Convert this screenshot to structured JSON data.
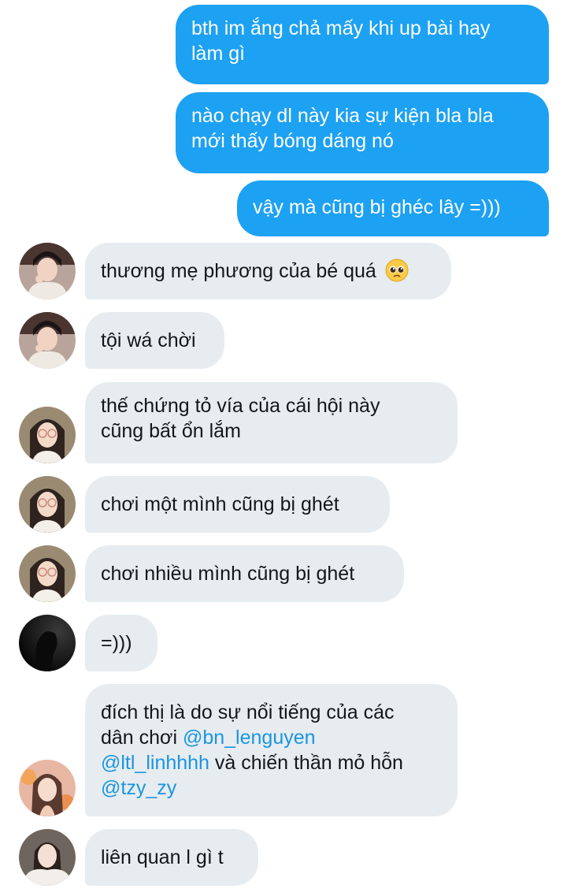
{
  "messages": {
    "sent": [
      {
        "lines": [
          "bth im ắng chả mấy khi up bài hay",
          "làm gì"
        ]
      },
      {
        "lines": [
          "nào chạy dl này kia sự kiện bla bla",
          "mới thấy bóng dáng nó"
        ]
      },
      {
        "lines": [
          "vậy mà cũng bị ghéc lây =)))"
        ]
      }
    ],
    "received": [
      {
        "text": "thương mẹ phương của bé quá",
        "emoji": "pleading-face-icon"
      },
      {
        "text": "tội wá chời"
      },
      {
        "lines": [
          "thế chứng tỏ vía của cái hội này",
          "cũng bất ổn lắm"
        ]
      },
      {
        "text": "chơi một mình cũng bị ghét"
      },
      {
        "text": "chơi nhiều mình cũng bị ghét"
      },
      {
        "text": "=)))"
      },
      {
        "line1": "đích thị là do sự nổi tiếng của các",
        "line2_prefix": "dân chơi ",
        "mention1": "@bn_lenguyen",
        "mention2": "@ltl_linhhhh",
        "line3_suffix": " và chiến thần mỏ hỗn",
        "mention3": "@tzy_zy"
      },
      {
        "text": "liên quan l gì t"
      }
    ]
  },
  "colors": {
    "sent_bubble": "#1da1f2",
    "received_bubble": "#e6ecf0",
    "mention": "#1b95e0"
  }
}
